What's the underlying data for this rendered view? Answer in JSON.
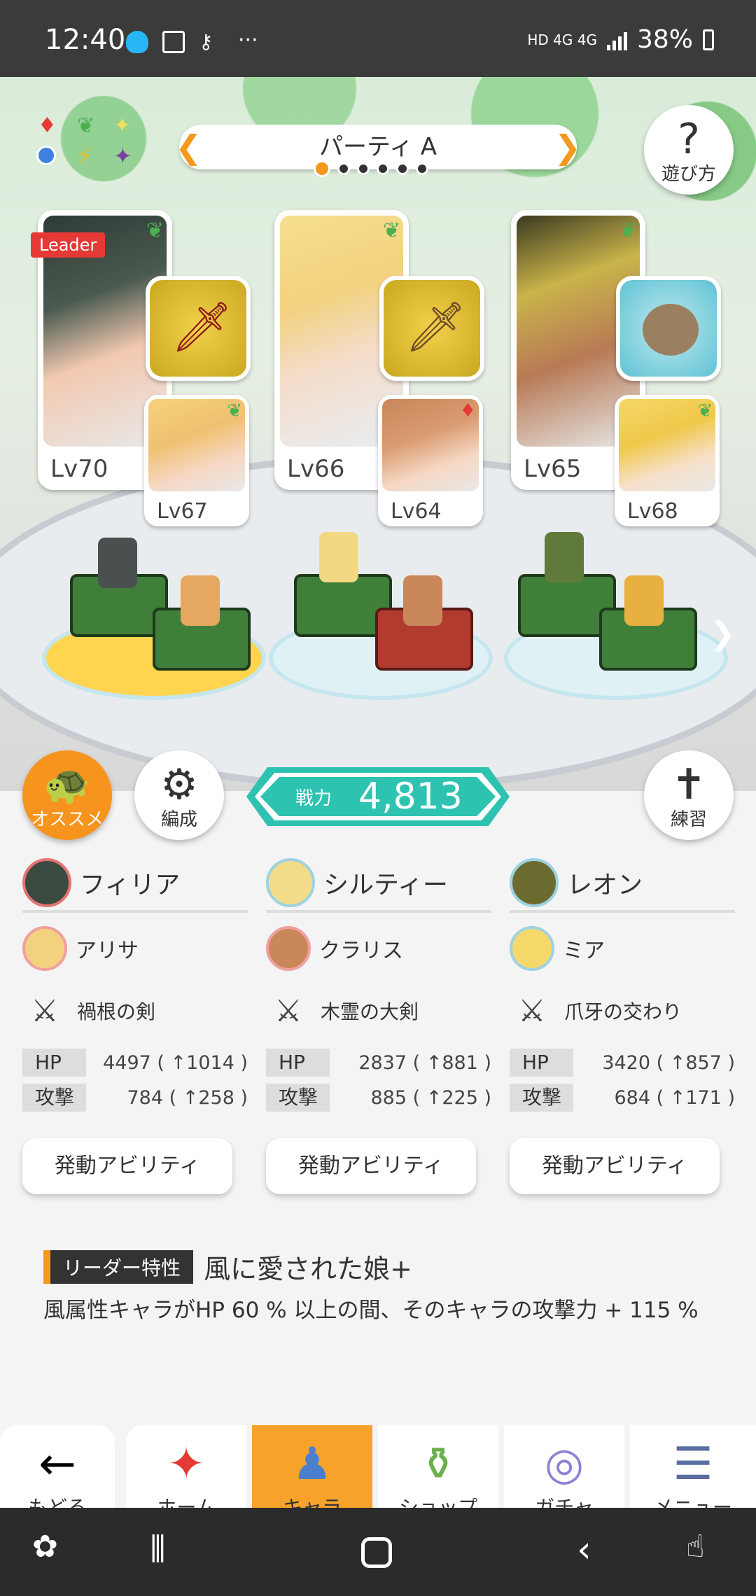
{
  "status": {
    "time": "12:40",
    "network": "HD 4G 4G",
    "battery": "38%"
  },
  "party": {
    "name": "パーティ A",
    "page_count": 6,
    "page_index": 0
  },
  "buttons": {
    "help": "遊び方",
    "recommend": "オススメ",
    "formation": "編成",
    "practice": "練習"
  },
  "leader_tag": "Leader",
  "slots": [
    {
      "main_lv": "Lv70",
      "sub_lv": "Lv67"
    },
    {
      "main_lv": "Lv66",
      "sub_lv": "Lv64"
    },
    {
      "main_lv": "Lv65",
      "sub_lv": "Lv68"
    }
  ],
  "power": {
    "label": "戦力",
    "value": "4,813"
  },
  "members": [
    {
      "leader": "フィリア",
      "sub": "アリサ",
      "weapon": "禍根の剣",
      "hp_label": "HP",
      "hp": "4497 ( ↑1014 )",
      "atk_label": "攻撃",
      "atk": "784 ( ↑258 )",
      "ability": "発動アビリティ"
    },
    {
      "leader": "シルティー",
      "sub": "クラリス",
      "weapon": "木霊の大剣",
      "hp_label": "HP",
      "hp": "2837 ( ↑881 )",
      "atk_label": "攻撃",
      "atk": "885 ( ↑225 )",
      "ability": "発動アビリティ"
    },
    {
      "leader": "レオン",
      "sub": "ミア",
      "weapon": "爪牙の交わり",
      "hp_label": "HP",
      "hp": "3420 ( ↑857 )",
      "atk_label": "攻撃",
      "atk": "684 ( ↑171 )",
      "ability": "発動アビリティ"
    }
  ],
  "leader_trait": {
    "badge": "リーダー特性",
    "title": "風に愛された娘+",
    "desc": "風属性キャラがHP 60 % 以上の間、そのキャラの攻撃力 + 115 %"
  },
  "nav": [
    {
      "label": "もどる",
      "icon": "back-arrow-icon"
    },
    {
      "label": "ホーム",
      "icon": "home-icon"
    },
    {
      "label": "キャラ",
      "icon": "character-icon"
    },
    {
      "label": "ショップ",
      "icon": "shop-icon"
    },
    {
      "label": "ガチャ",
      "icon": "gacha-icon"
    },
    {
      "label": "メニュー",
      "icon": "menu-icon"
    }
  ],
  "colors": {
    "accent": "#f7a32b",
    "power": "#2ec2b1",
    "wind": "#4caf50",
    "fire": "#e53935"
  }
}
